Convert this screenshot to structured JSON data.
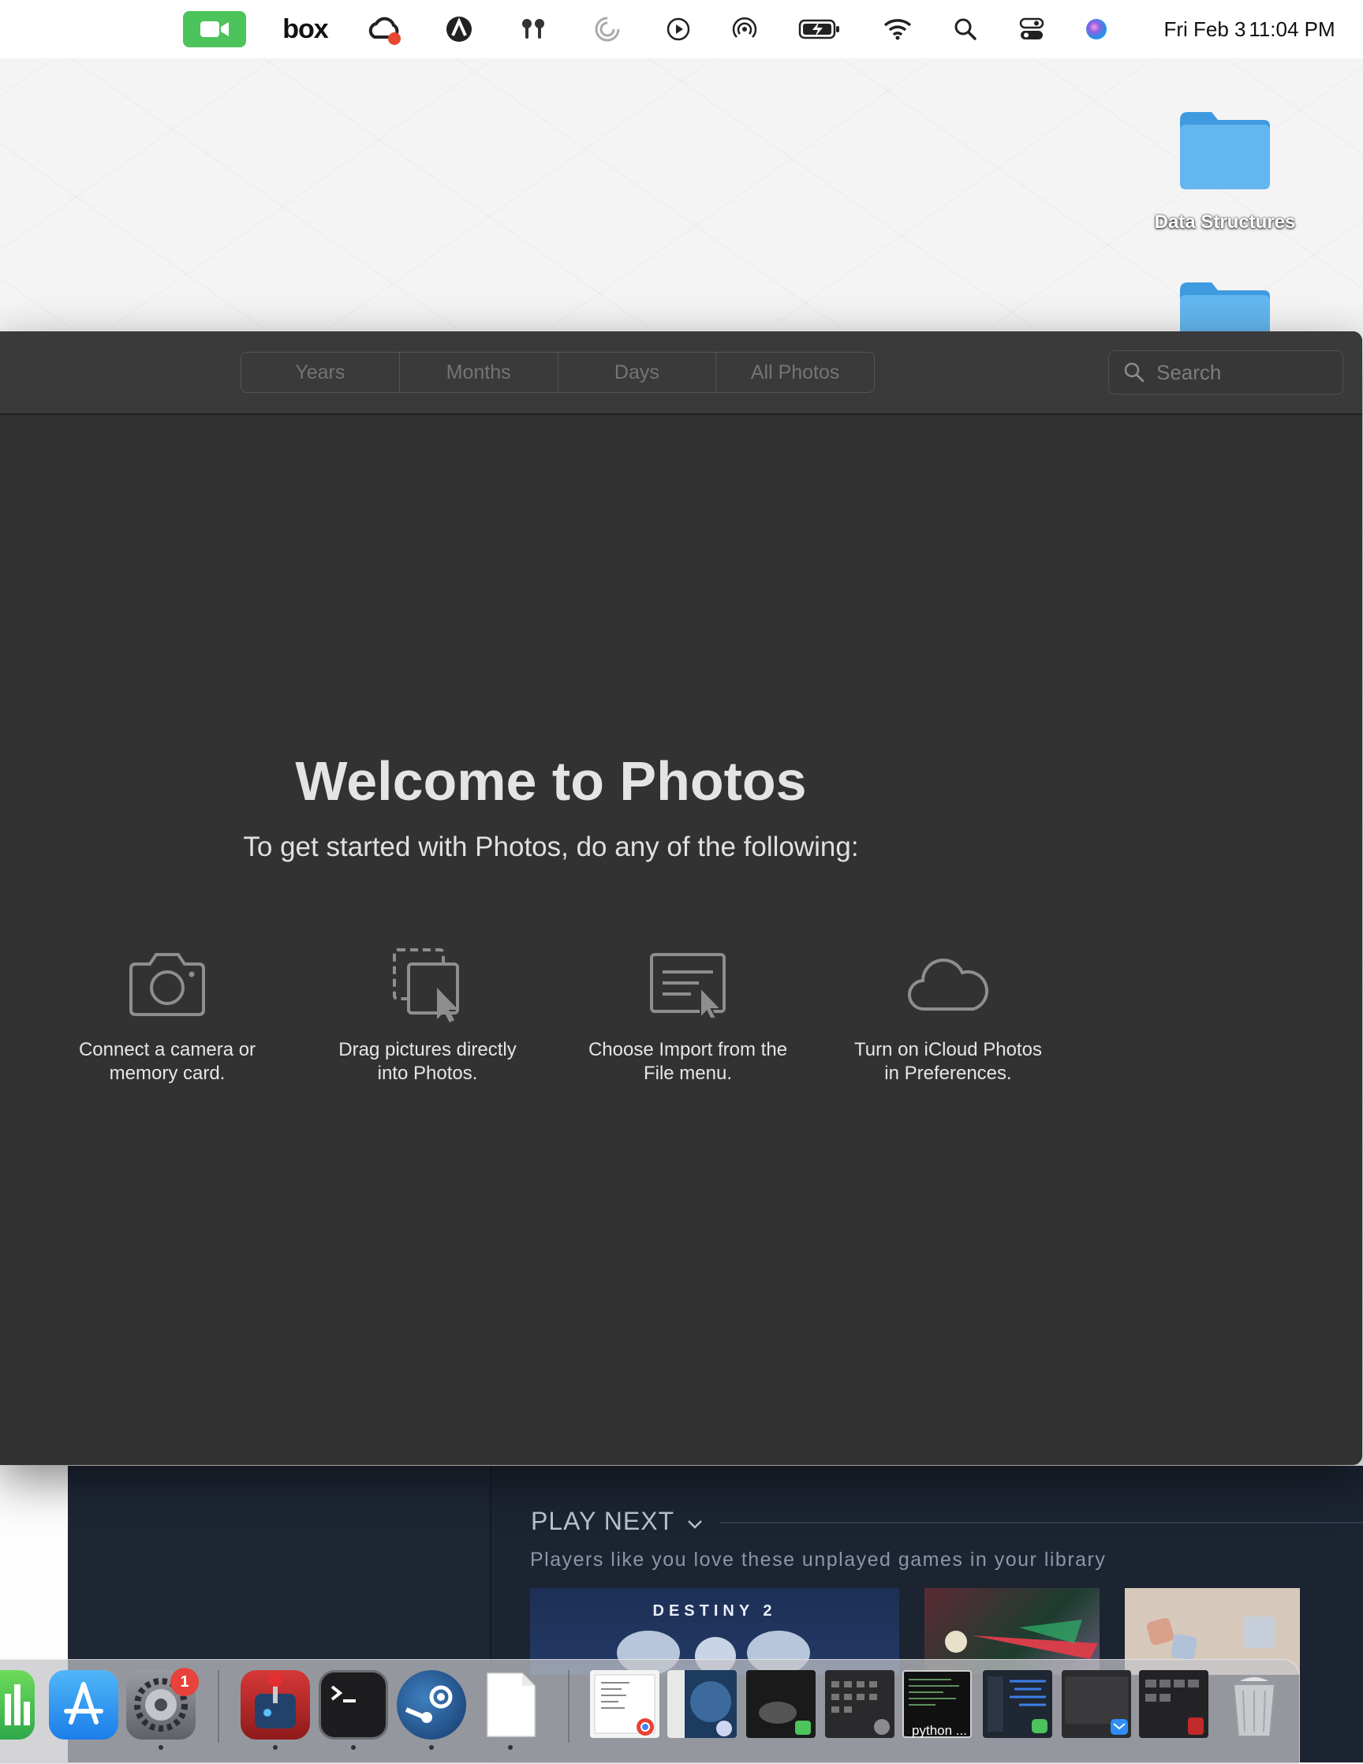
{
  "menubar": {
    "date": "Fri Feb 3",
    "time": "11:04 PM",
    "box_label": "box",
    "icons": [
      "facetime-icon",
      "box-icon",
      "creative-cloud-icon",
      "astro-icon",
      "airpods-icon",
      "moon-icon",
      "play-icon",
      "airdrop-icon",
      "battery-icon",
      "wifi-icon",
      "spotlight-icon",
      "control-center-icon",
      "siri-icon"
    ],
    "facetime_color": "#4cc35b"
  },
  "desktop": {
    "folders": [
      {
        "label": "Data Structures"
      },
      {
        "label": ""
      }
    ],
    "folder_color": "#4ba8e8"
  },
  "photos": {
    "segments": [
      "Years",
      "Months",
      "Days",
      "All Photos"
    ],
    "search_placeholder": "Search",
    "welcome_title": "Welcome to Photos",
    "welcome_sub": "To get started with Photos, do any of the following:",
    "options": [
      {
        "icon": "camera-icon",
        "text": "Connect a camera or\nmemory card."
      },
      {
        "icon": "drag-icon",
        "text": "Drag pictures directly\ninto Photos."
      },
      {
        "icon": "import-icon",
        "text": "Choose Import from the\nFile menu."
      },
      {
        "icon": "cloud-icon",
        "text": "Turn on iCloud Photos\nin Preferences."
      }
    ]
  },
  "steam": {
    "play_next": "PLAY NEXT",
    "play_next_sub": "Players like you love these unplayed games in your library",
    "destiny_title": "DESTINY 2"
  },
  "dock": {
    "apps": [
      "numbers-icon",
      "app-store-icon",
      "system-settings-icon",
      "joystick-app-icon",
      "terminal-icon",
      "steam-icon",
      "document-icon"
    ],
    "settings_badge": "1",
    "window_thumb_label": "python ...",
    "trash": "trash-icon"
  }
}
